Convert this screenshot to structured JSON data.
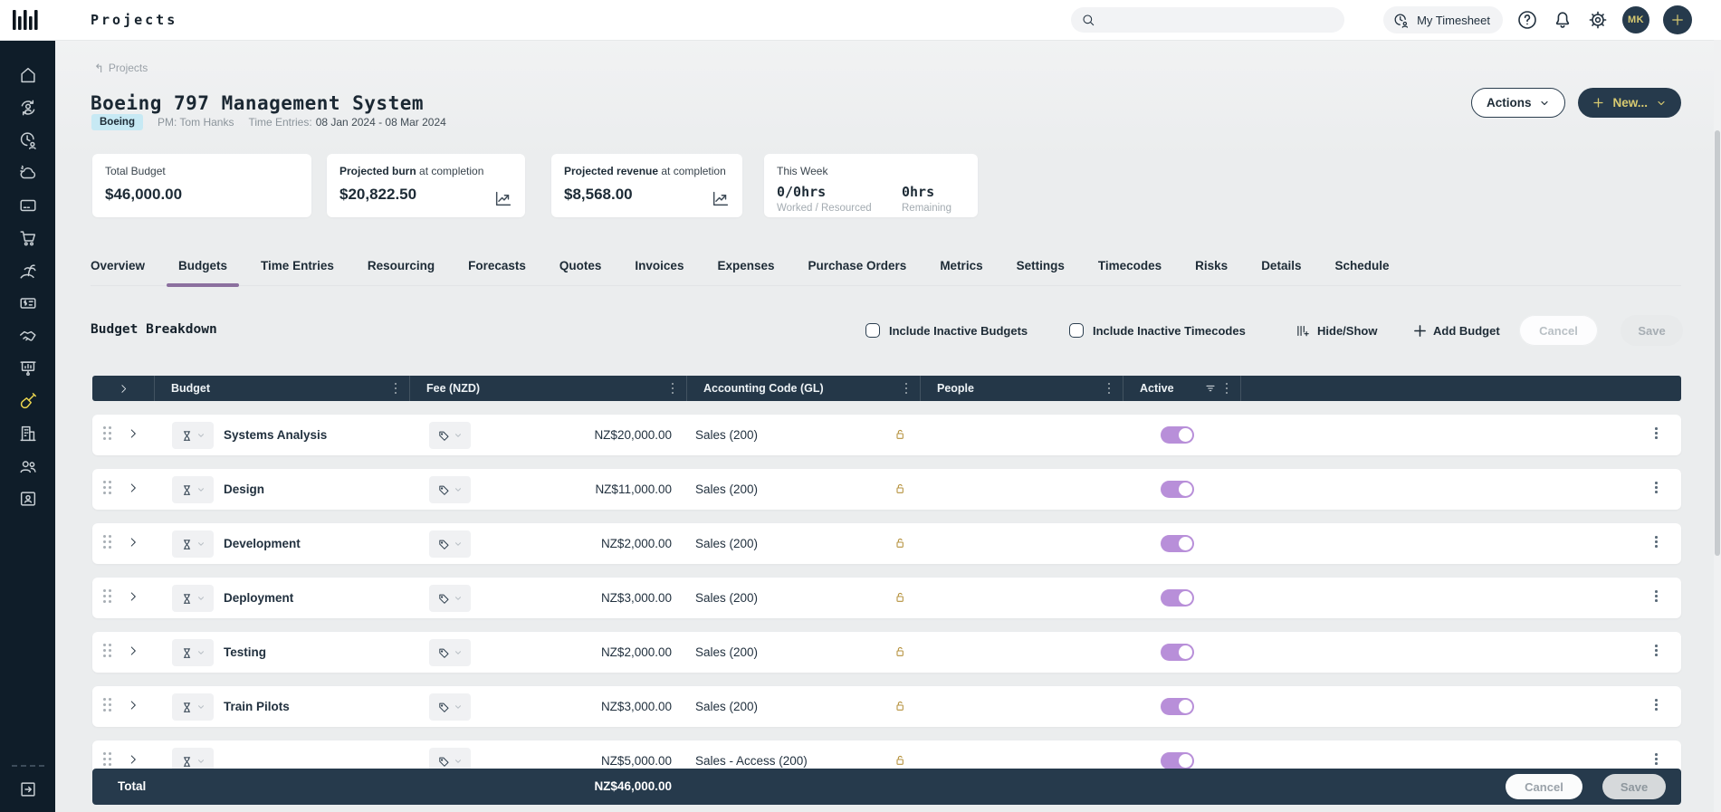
{
  "topbar": {
    "title": "Projects",
    "search_placeholder": "",
    "my_timesheet": "My Timesheet",
    "avatar_initials": "MK"
  },
  "sidebar": {
    "icons": [
      "home",
      "user-refresh",
      "clock-user",
      "cloud",
      "credit-card",
      "shopping-cart",
      "palm-tree",
      "money-note",
      "handshake",
      "presentation-chart",
      "shovel",
      "building",
      "people",
      "id-card"
    ],
    "active_icon": "shovel",
    "bottom_icon": "arrow-right-square"
  },
  "header": {
    "breadcrumb": "Projects",
    "title": "Boeing 797 Management System",
    "badge": "Boeing",
    "pm": "PM: Tom Hanks",
    "time_entries_label": "Time Entries:",
    "time_entries_value": "08 Jan 2024 - 08 Mar 2024",
    "actions_button": "Actions",
    "new_button": "New..."
  },
  "stats": {
    "total_budget": {
      "label": "Total Budget",
      "value": "$46,000.00"
    },
    "projected_burn": {
      "label_bold": "Projected burn",
      "label_rest": " at completion",
      "value": "$20,822.50"
    },
    "projected_revenue": {
      "label_bold": "Projected revenue",
      "label_rest": " at completion",
      "value": "$8,568.00"
    },
    "this_week": {
      "label": "This Week",
      "worked_value": "0/0hrs",
      "worked_label": "Worked / Resourced",
      "remaining_value": "0hrs",
      "remaining_label": "Remaining"
    }
  },
  "tabs": {
    "items": [
      "Overview",
      "Budgets",
      "Time Entries",
      "Resourcing",
      "Forecasts",
      "Quotes",
      "Invoices",
      "Expenses",
      "Purchase Orders",
      "Metrics",
      "Settings",
      "Timecodes",
      "Risks",
      "Details",
      "Schedule"
    ],
    "active": "Budgets"
  },
  "budget_toolbar": {
    "heading": "Budget Breakdown",
    "include_inactive_budgets": {
      "label": "Include Inactive Budgets",
      "checked": false
    },
    "include_inactive_timecodes": {
      "label": "Include Inactive Timecodes",
      "checked": false
    },
    "hide_show": "Hide/Show",
    "add_budget": "Add Budget",
    "cancel": "Cancel",
    "save": "Save"
  },
  "table": {
    "columns": [
      "Budget",
      "Fee (NZD)",
      "Accounting Code (GL)",
      "People",
      "Active"
    ],
    "rows": [
      {
        "name": "Systems Analysis",
        "fee": "NZ$20,000.00",
        "accounting_code": "Sales (200)",
        "active": true
      },
      {
        "name": "Design",
        "fee": "NZ$11,000.00",
        "accounting_code": "Sales (200)",
        "active": true
      },
      {
        "name": "Development",
        "fee": "NZ$2,000.00",
        "accounting_code": "Sales (200)",
        "active": true
      },
      {
        "name": "Deployment",
        "fee": "NZ$3,000.00",
        "accounting_code": "Sales (200)",
        "active": true
      },
      {
        "name": "Testing",
        "fee": "NZ$2,000.00",
        "accounting_code": "Sales (200)",
        "active": true
      },
      {
        "name": "Train Pilots",
        "fee": "NZ$3,000.00",
        "accounting_code": "Sales (200)",
        "active": true
      },
      {
        "name": "",
        "fee": "NZ$5,000.00",
        "accounting_code": "Sales - Access (200)",
        "active": true,
        "partial": true
      }
    ]
  },
  "footer": {
    "total_label": "Total",
    "total_value": "NZ$46,000.00",
    "cancel": "Cancel",
    "save": "Save"
  },
  "colors": {
    "accent_purple": "#8b6f9e",
    "toggle_purple": "#b88fd9",
    "header_navy": "#243748",
    "sidebar_navy": "#0f1d29",
    "gold": "#d8ca70",
    "lock_gold": "#b5913c",
    "badge_blue": "#c7e9f4"
  }
}
